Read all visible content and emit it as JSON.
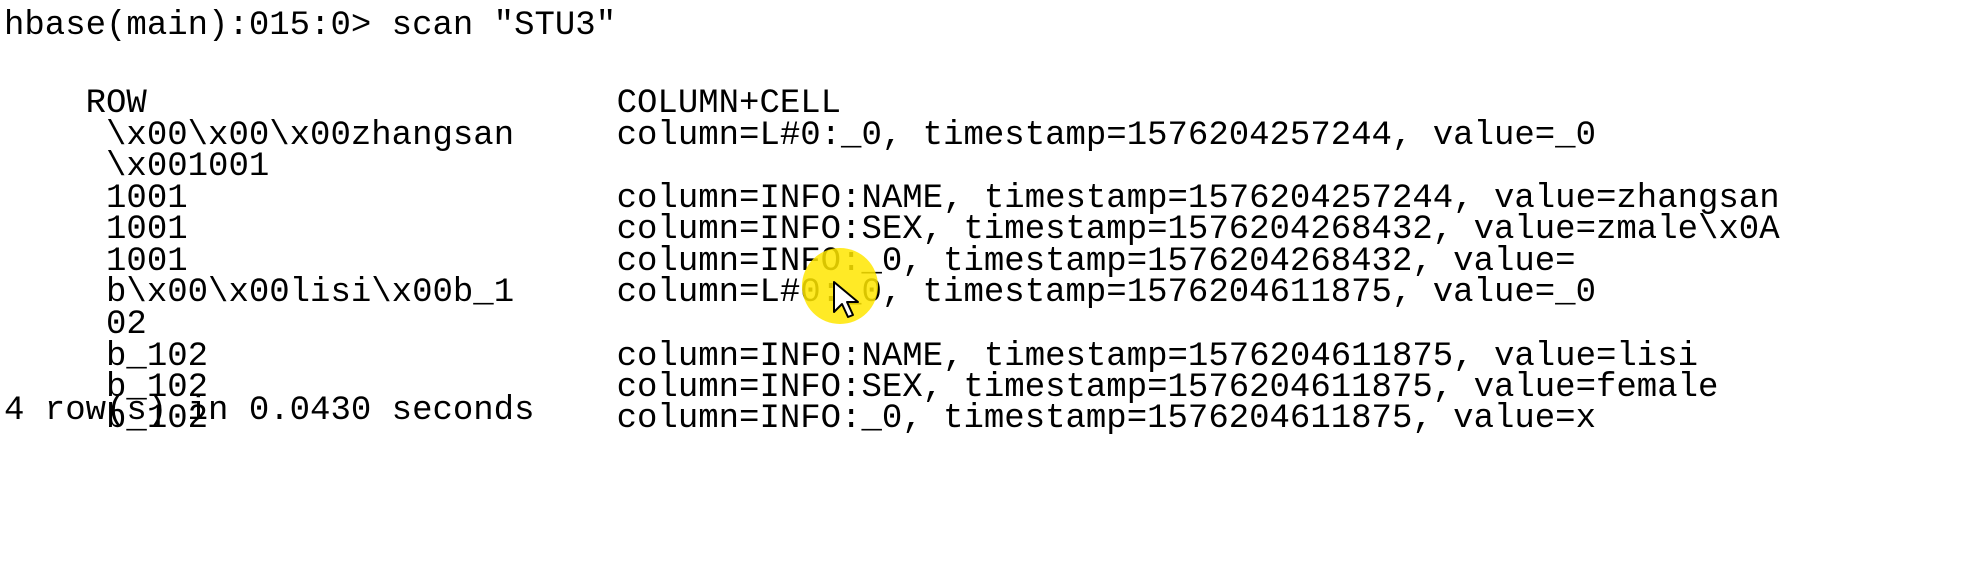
{
  "terminal": {
    "prompt_line": "hbase(main):015:0> scan \"STU3\"",
    "header": {
      "row": "ROW",
      "column_cell": "COLUMN+CELL"
    },
    "rows": [
      {
        "key": " \\x00\\x00\\x00zhangsan",
        "cell": "column=L#0:_0, timestamp=1576204257244, value=_0"
      },
      {
        "key": " \\x001001",
        "cell": ""
      },
      {
        "key": " 1001",
        "cell": "column=INFO:NAME, timestamp=1576204257244, value=zhangsan"
      },
      {
        "key": " 1001",
        "cell": "column=INFO:SEX, timestamp=1576204268432, value=zmale\\x0A"
      },
      {
        "key": " 1001",
        "cell": "column=INFO:_0, timestamp=1576204268432, value="
      },
      {
        "key": " b\\x00\\x00lisi\\x00b_1",
        "cell": "column=L#0:_0, timestamp=1576204611875, value=_0"
      },
      {
        "key": " 02",
        "cell": ""
      },
      {
        "key": " b_102",
        "cell": "column=INFO:NAME, timestamp=1576204611875, value=lisi"
      },
      {
        "key": " b_102",
        "cell": "column=INFO:SEX, timestamp=1576204611875, value=female"
      },
      {
        "key": " b_102",
        "cell": "column=INFO:_0, timestamp=1576204611875, value=x"
      }
    ],
    "summary": "4 row(s) in 0.0430 seconds"
  },
  "colors": {
    "background": "#ffffff",
    "text": "#000000",
    "cursor_highlight": "#ffe600"
  },
  "icons": {
    "cursor": "mouse-pointer-icon"
  }
}
